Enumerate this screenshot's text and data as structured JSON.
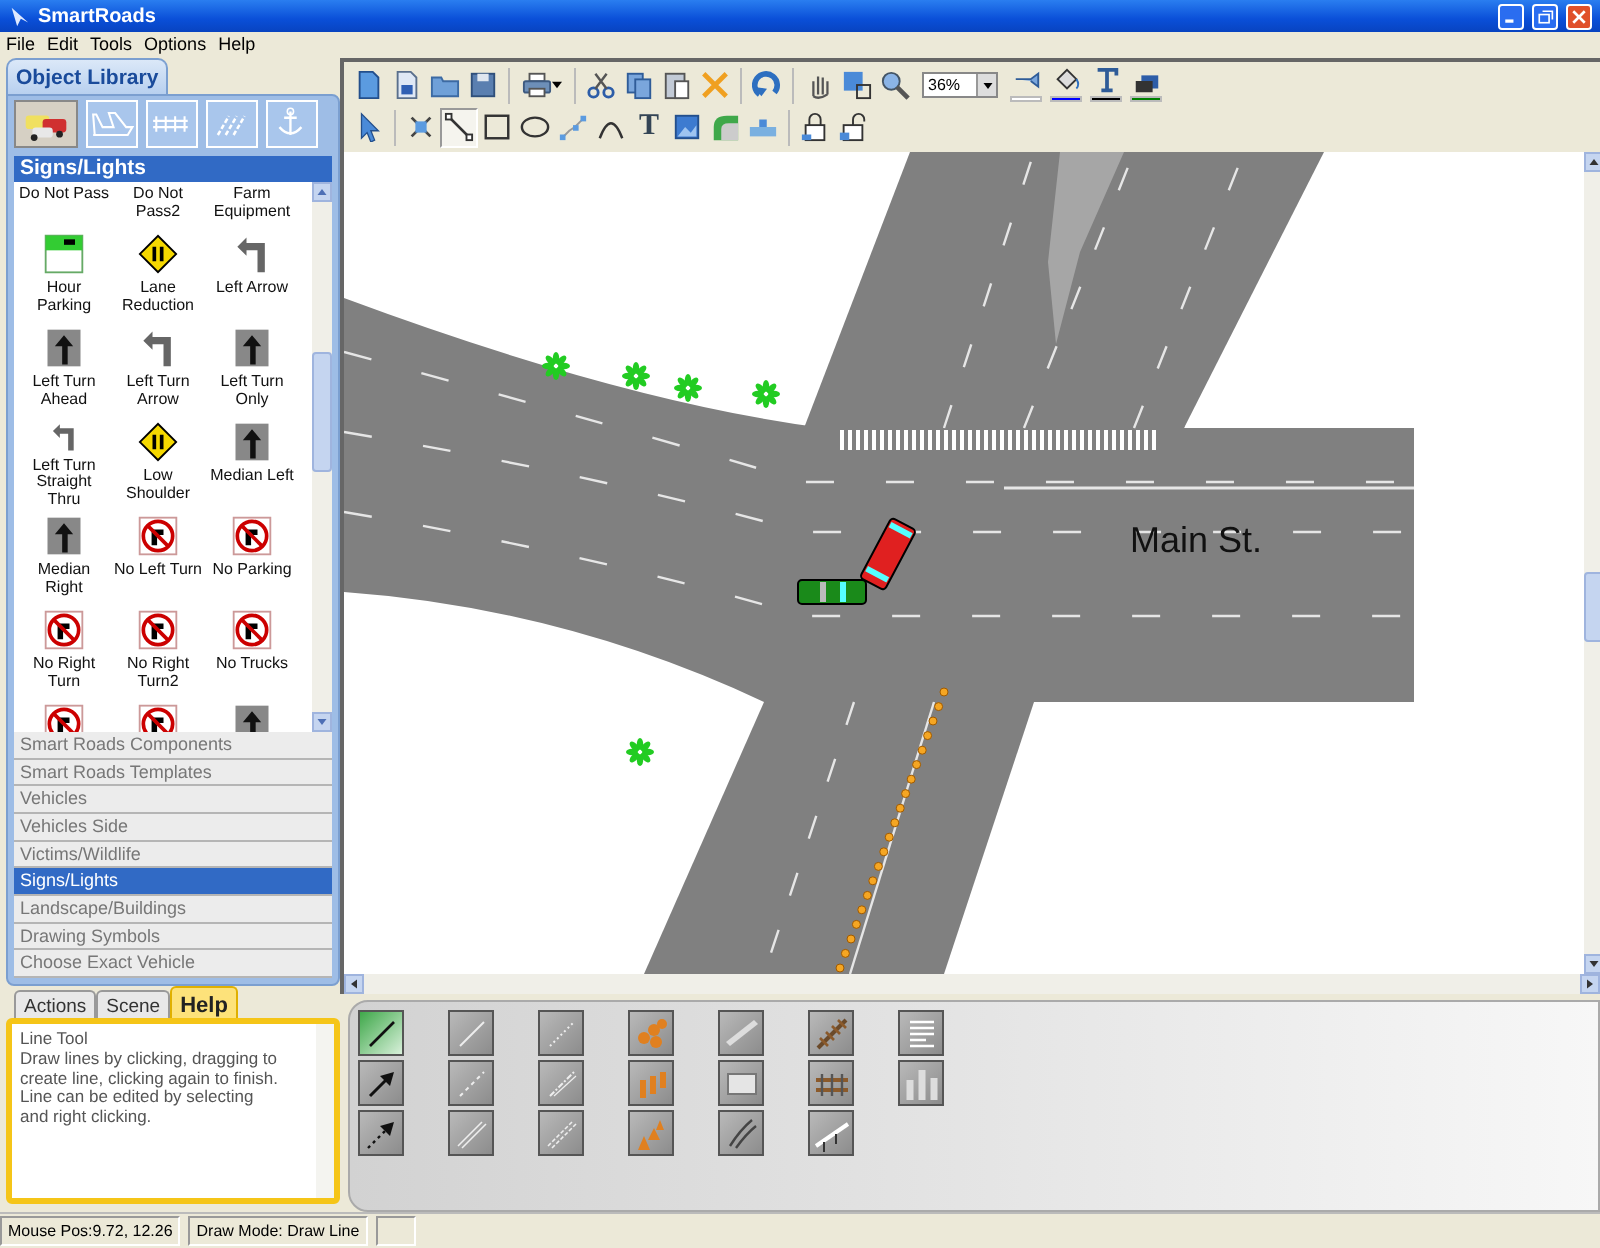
{
  "window": {
    "title": "SmartRoads"
  },
  "menu": [
    "File",
    "Edit",
    "Tools",
    "Options",
    "Help"
  ],
  "object_library": {
    "title": "Object Library",
    "category_tabs": [
      {
        "kind": "vehicles",
        "selected": true
      },
      {
        "kind": "aircraft",
        "selected": false
      },
      {
        "kind": "fence",
        "selected": false
      },
      {
        "kind": "markings",
        "selected": false
      },
      {
        "kind": "anchor",
        "selected": false
      }
    ],
    "heading": "Signs/Lights",
    "items": [
      {
        "label": "Do Not Pass",
        "kind": "cut"
      },
      {
        "label": "Do Not Pass2",
        "kind": "cut"
      },
      {
        "label": "Farm Equipment",
        "kind": "cut"
      },
      {
        "label": "Hour Parking",
        "kind": "parking"
      },
      {
        "label": "Lane Reduction",
        "kind": "diamond"
      },
      {
        "label": "Left Arrow",
        "kind": "arrow"
      },
      {
        "label": "Left Turn Ahead",
        "kind": "plate"
      },
      {
        "label": "Left Turn Arrow",
        "kind": "arrow"
      },
      {
        "label": "Left Turn Only",
        "kind": "plate"
      },
      {
        "label": "Left Turn Straight Thru",
        "kind": "arrow"
      },
      {
        "label": "Low Shoulder",
        "kind": "diamond"
      },
      {
        "label": "Median Left",
        "kind": "plate"
      },
      {
        "label": "Median Right",
        "kind": "plate"
      },
      {
        "label": "No Left Turn",
        "kind": "prohibit"
      },
      {
        "label": "No Parking",
        "kind": "prohibit"
      },
      {
        "label": "No Right Turn",
        "kind": "prohibit"
      },
      {
        "label": "No Right Turn2",
        "kind": "prohibit"
      },
      {
        "label": "No Trucks",
        "kind": "prohibit"
      },
      {
        "kind": "prohibit"
      },
      {
        "kind": "prohibit"
      },
      {
        "kind": "plate"
      }
    ],
    "categories": [
      {
        "label": "Smart Roads Components",
        "selected": false
      },
      {
        "label": "Smart Roads Templates",
        "selected": false
      },
      {
        "label": "Vehicles",
        "selected": false
      },
      {
        "label": "Vehicles Side",
        "selected": false
      },
      {
        "label": "Victims/Wildlife",
        "selected": false
      },
      {
        "label": "Signs/Lights",
        "selected": true
      },
      {
        "label": "Landscape/Buildings",
        "selected": false
      },
      {
        "label": "Drawing Symbols",
        "selected": false
      },
      {
        "label": "Choose Exact Vehicle",
        "selected": false
      }
    ]
  },
  "toolbar": {
    "row_1": [
      [
        {
          "kind": "new"
        },
        {
          "kind": "document"
        },
        {
          "kind": "open"
        },
        {
          "kind": "save"
        }
      ],
      [
        {
          "kind": "print"
        }
      ],
      [
        {
          "kind": "cut"
        },
        {
          "kind": "copy"
        },
        {
          "kind": "paste"
        },
        {
          "kind": "delete"
        }
      ],
      [
        {
          "kind": "undo"
        }
      ],
      [
        {
          "kind": "pan"
        },
        {
          "kind": "zoom-window"
        },
        {
          "kind": "zoom"
        },
        {
          "kind": "zoom-level",
          "value": "36%"
        },
        {
          "kind": "line-color",
          "color": "#ffffff"
        },
        {
          "kind": "fill-color",
          "color": "#0000ff"
        },
        {
          "kind": "text-color",
          "color": "#000000"
        },
        {
          "kind": "shadow-color",
          "color": "#008000"
        }
      ]
    ],
    "row_2": [
      [
        {
          "kind": "pointer",
          "selected": false
        }
      ],
      [
        {
          "kind": "node-edit",
          "selected": false
        },
        {
          "kind": "line",
          "selected": true
        },
        {
          "kind": "rectangle",
          "selected": false
        },
        {
          "kind": "ellipse",
          "selected": false
        },
        {
          "kind": "polyline",
          "selected": false
        },
        {
          "kind": "arc",
          "selected": false
        },
        {
          "kind": "text",
          "label": "T",
          "selected": false
        },
        {
          "kind": "image",
          "selected": false
        },
        {
          "kind": "curve-road",
          "selected": false
        },
        {
          "kind": "straight-road",
          "selected": false
        }
      ],
      [
        {
          "kind": "lock",
          "selected": false
        },
        {
          "kind": "unlock",
          "selected": false
        }
      ]
    ]
  },
  "canvas": {
    "street_label": "Main St."
  },
  "palette": {
    "columns": [
      [
        {
          "kind": "line",
          "selected": true
        },
        {
          "kind": "arrow",
          "selected": false
        },
        {
          "kind": "dashed-arrow",
          "selected": false
        }
      ],
      [
        {
          "kind": "white-line",
          "selected": false
        },
        {
          "kind": "dashed-white-line",
          "selected": false
        },
        {
          "kind": "double-white-line",
          "selected": false
        }
      ],
      [
        {
          "kind": "dotted-line",
          "selected": false
        },
        {
          "kind": "dash-dot-line",
          "selected": false
        },
        {
          "kind": "double-dashed-line",
          "selected": false
        }
      ],
      [
        {
          "kind": "cones",
          "selected": false
        },
        {
          "kind": "posts",
          "selected": false
        },
        {
          "kind": "cone-row",
          "selected": false
        }
      ],
      [
        {
          "kind": "guardrail",
          "selected": false
        },
        {
          "kind": "barrier",
          "selected": false
        },
        {
          "kind": "skid-marks",
          "selected": false
        }
      ],
      [
        {
          "kind": "railroad",
          "selected": false
        },
        {
          "kind": "rail-crossing",
          "selected": false
        },
        {
          "kind": "railing",
          "selected": false
        }
      ],
      [
        {
          "kind": "text-block",
          "selected": false
        },
        {
          "kind": "chart",
          "selected": false
        }
      ]
    ]
  },
  "side_tabs": [
    {
      "label": "Actions",
      "selected": false
    },
    {
      "label": "Scene",
      "selected": false
    },
    {
      "label": "Help",
      "selected": true
    }
  ],
  "help": {
    "title": "Line Tool",
    "paragraphs": [
      "Draw lines by clicking, dragging to create line, clicking again to finish.",
      "Line can be edited by selecting and right clicking."
    ]
  },
  "status_bar": [
    "Mouse Pos:9.72, 12.26",
    "Draw Mode: Draw Line"
  ]
}
